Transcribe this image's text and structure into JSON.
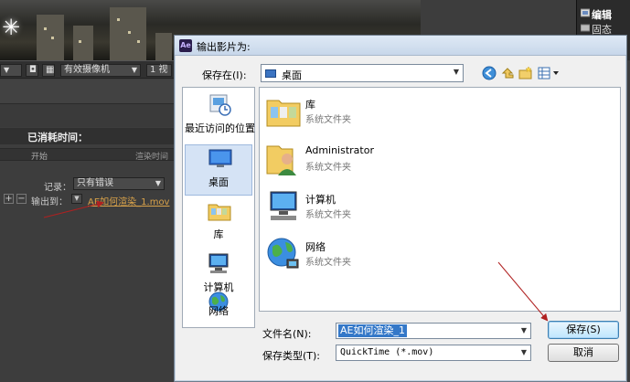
{
  "ae": {
    "toolbar": {
      "zoom_caret": "▼",
      "camera": "有效摄像机",
      "views": "1 视"
    },
    "render_queue": {
      "elapsed_label": "已消耗时间：",
      "col_start": "开始",
      "col_render_time": "渲染时间",
      "log_label": "记录：",
      "log_value": "只有错误",
      "output_label": "输出到：",
      "output_file": "AE如何渲染_1.mov"
    },
    "project": {
      "row1": "编辑",
      "row2": "固态"
    }
  },
  "dialog": {
    "title": "输出影片为:",
    "app_logo": "Ae",
    "save_in_label": "保存在(I):",
    "save_in_value": "桌面",
    "places": [
      {
        "label": "最近访问的位置",
        "icon": "recent-places-icon"
      },
      {
        "label": "桌面",
        "icon": "desktop-icon"
      },
      {
        "label": "库",
        "icon": "library-icon"
      },
      {
        "label": "计算机",
        "icon": "computer-icon"
      },
      {
        "label": "网络",
        "icon": "network-icon"
      }
    ],
    "files": [
      {
        "name": "库",
        "type": "系统文件夹",
        "icon": "library-folder-icon"
      },
      {
        "name": "Administrator",
        "type": "系统文件夹",
        "icon": "user-folder-icon"
      },
      {
        "name": "计算机",
        "type": "系统文件夹",
        "icon": "computer-icon"
      },
      {
        "name": "网络",
        "type": "系统文件夹",
        "icon": "network-icon"
      }
    ],
    "filename_label": "文件名(N):",
    "filename_value": "AE如何渲染_1",
    "filetype_label": "保存类型(T):",
    "filetype_value": "QuickTime (*.mov)",
    "save_button": "保存(S)",
    "cancel_button": "取消"
  },
  "colors": {
    "annotation_arrow": "#b02020",
    "selection": "#3478c8",
    "output_file": "#d9a24a"
  }
}
